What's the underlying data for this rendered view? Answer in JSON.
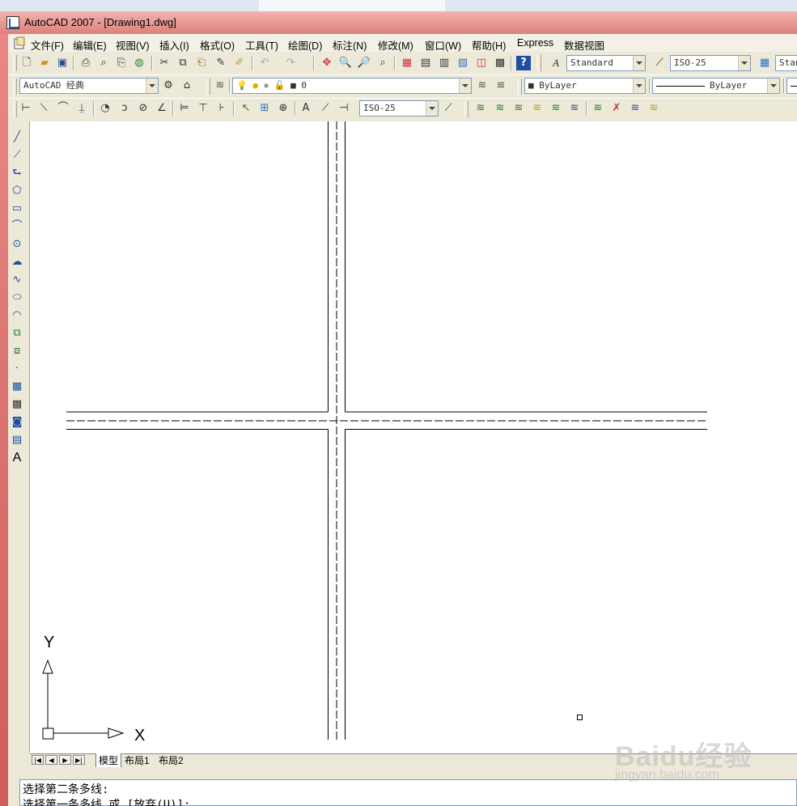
{
  "window": {
    "title": "AutoCAD 2007 - [Drawing1.dwg]"
  },
  "menu": {
    "items": [
      "文件(F)",
      "编辑(E)",
      "视图(V)",
      "插入(I)",
      "格式(O)",
      "工具(T)",
      "绘图(D)",
      "标注(N)",
      "修改(M)",
      "窗口(W)",
      "帮助(H)",
      "Express",
      "数据视图"
    ]
  },
  "toolbars": {
    "text_style": "Standard",
    "dim_style": "ISO-25",
    "table_style": "Stan",
    "workspace": "AutoCAD 经典",
    "layer_name": "0",
    "color": "ByLayer",
    "linetype": "ByLayer",
    "dim_style_2": "ISO-25"
  },
  "ucs": {
    "x_label": "X",
    "y_label": "Y"
  },
  "tabs": {
    "items": [
      "模型",
      "布局1",
      "布局2"
    ],
    "active": "模型"
  },
  "command": {
    "lines": [
      "选择第二条多线:",
      "选择第一条多线 或 [放弃(U)]:"
    ]
  },
  "watermark": {
    "brand": "Baidu经验",
    "url": "jingyan.baidu.com"
  },
  "icons": {
    "left_toolbar": [
      "line-icon",
      "construction-line-icon",
      "polyline-icon",
      "polygon-icon",
      "rectangle-icon",
      "arc-icon",
      "circle-icon",
      "revision-cloud-icon",
      "spline-icon",
      "ellipse-icon",
      "ellipse-arc-icon",
      "insert-block-icon",
      "make-block-icon",
      "point-icon",
      "hatch-icon",
      "gradient-icon",
      "region-icon",
      "table-icon",
      "mtext-icon"
    ]
  }
}
